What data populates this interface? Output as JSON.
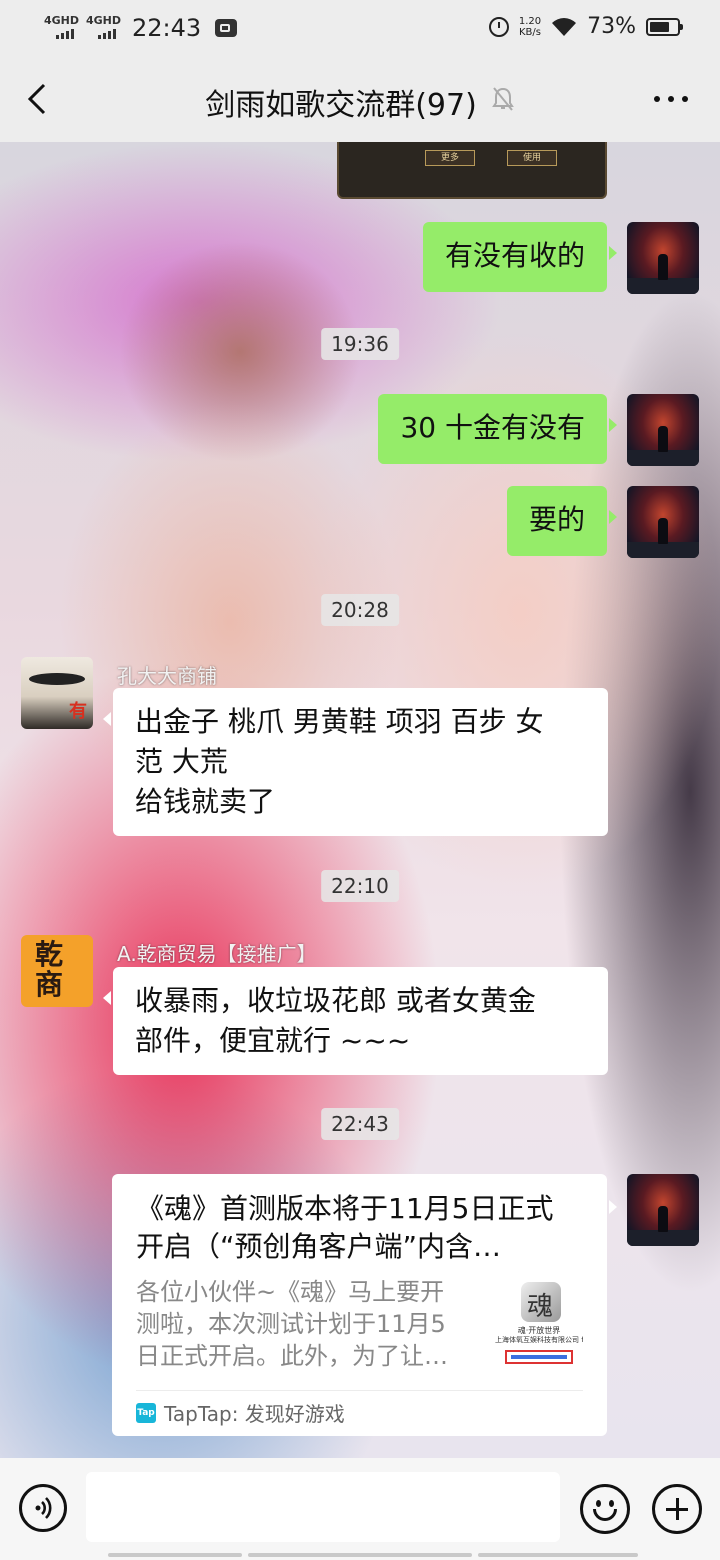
{
  "status_bar": {
    "network1": "4GHD",
    "network2": "4GHD",
    "time": "22:43",
    "net_speed_value": "1.20",
    "net_speed_unit": "KB/s",
    "battery_pct": "73%",
    "battery_level": 0.73
  },
  "header": {
    "title": "剑雨如歌交流群(97)",
    "muted": true
  },
  "game_image": {
    "btn_more": "更多",
    "btn_use": "使用"
  },
  "messages": [
    {
      "side": "right",
      "text": "有没有收的"
    },
    {
      "type": "time",
      "text": "19:36"
    },
    {
      "side": "right",
      "text": "30 十金有没有"
    },
    {
      "side": "right",
      "text": "要的"
    },
    {
      "type": "time",
      "text": "20:28"
    },
    {
      "side": "left",
      "sender": "孔大大商铺",
      "line1": "出金子 桃爪 男黄鞋 项羽 百步 女",
      "line2": "范 大荒",
      "line3": "给钱就卖了"
    },
    {
      "type": "time",
      "text": "22:10"
    },
    {
      "side": "left",
      "sender": "A.乾商贸易【接推广】",
      "line1": "收暴雨，收垃圾花郎 或者女黄金",
      "line2": "部件，便宜就行 ~~~"
    },
    {
      "type": "time",
      "text": "22:43"
    }
  ],
  "avatars": {
    "kong_char": "有",
    "qian_char1": "乾",
    "qian_char2": "商"
  },
  "link_card": {
    "title_line1": "《魂》首测版本将于11月5日正式",
    "title_line2": "开启（“预创角客户端”内含…",
    "desc_line1": "各位小伙伴~《魂》马上要开",
    "desc_line2": "测啦，本次测试计划于11月5",
    "desc_line3": "日正式开启。此外，为了让…",
    "thumb_text1": "魂·开放世界",
    "thumb_text2": "上海体氧互娱科技有限公司 for i",
    "source_icon": "Tap",
    "source": "TapTap: 发现好游戏"
  },
  "input_bar": {
    "value": ""
  }
}
